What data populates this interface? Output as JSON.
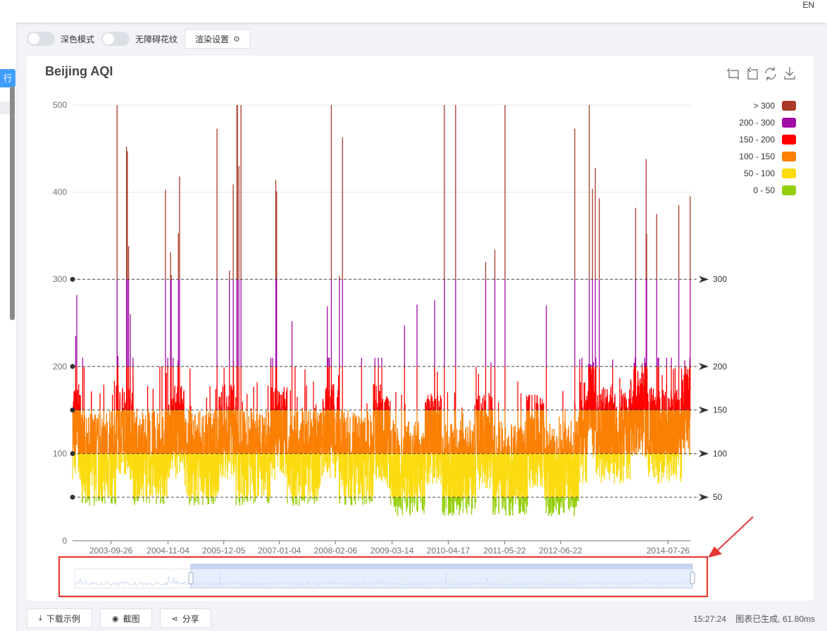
{
  "lang": "EN",
  "sidebar": {
    "run_label": "行"
  },
  "options": {
    "dark_mode": "深色模式",
    "a11y_pattern": "无障碍花纹",
    "render_settings": "渲染设置"
  },
  "bottom": {
    "download": "下载示例",
    "screenshot": "截图",
    "share": "分享"
  },
  "status": {
    "time": "15:27:24",
    "message": "图表已生成, 61.80ms"
  },
  "colors": {
    "gt300": "#aa3a28",
    "200-300": "#a10ba6",
    "150-200": "#ff0000",
    "100-150": "#fb7f03",
    "50-100": "#fbdb0f",
    "0-50": "#93ce07",
    "accent": "#409eff",
    "dataZoom": "#d6e2f8"
  },
  "chart_data": {
    "type": "line",
    "title": "Beijing AQI",
    "ylim": [
      0,
      500
    ],
    "yticks": [
      0,
      100,
      200,
      300,
      400,
      500
    ],
    "xticks": [
      "2003-09-26",
      "2004-11-04",
      "2005-12-05",
      "2007-01-04",
      "2008-02-06",
      "2009-03-14",
      "2010-04-17",
      "2011-05-22",
      "2012-06-22",
      "2014-07-26"
    ],
    "x_range": [
      "2002-12-27",
      "2014-12-31"
    ],
    "mark_lines": [
      50,
      100,
      150,
      200,
      300
    ],
    "mark_line_labels": [
      "50",
      "100",
      "150",
      "200",
      "300"
    ],
    "legend": [
      {
        "label": "> 300",
        "color_key": "gt300"
      },
      {
        "label": "200 - 300",
        "color_key": "200-300"
      },
      {
        "label": "150 - 200",
        "color_key": "150-200"
      },
      {
        "label": "100 - 150",
        "color_key": "100-150"
      },
      {
        "label": "50 - 100",
        "color_key": "50-100"
      },
      {
        "label": "0 - 50",
        "color_key": "0-50"
      }
    ],
    "peaks": [
      [
        "2003-01-18",
        235
      ],
      [
        "2003-01-26",
        282
      ],
      [
        "2003-11-08",
        500
      ],
      [
        "2003-11-14",
        212
      ],
      [
        "2004-01-14",
        452
      ],
      [
        "2004-01-20",
        447
      ],
      [
        "2004-01-29",
        338
      ],
      [
        "2004-02-10",
        260
      ],
      [
        "2004-10-17",
        403
      ],
      [
        "2004-11-22",
        331
      ],
      [
        "2004-11-27",
        305
      ],
      [
        "2005-01-17",
        353
      ],
      [
        "2005-01-25",
        418
      ],
      [
        "2005-10-18",
        473
      ],
      [
        "2006-01-14",
        310
      ],
      [
        "2006-02-10",
        409
      ],
      [
        "2006-03-08",
        500
      ],
      [
        "2006-03-12",
        500
      ],
      [
        "2006-03-22",
        430
      ],
      [
        "2006-04-06",
        500
      ],
      [
        "2006-12-09",
        414
      ],
      [
        "2006-12-15",
        401
      ],
      [
        "2007-04-03",
        252
      ],
      [
        "2007-12-10",
        269
      ],
      [
        "2008-01-08",
        500
      ],
      [
        "2008-03-05",
        304
      ],
      [
        "2008-03-27",
        463
      ],
      [
        "2009-06-10",
        247
      ],
      [
        "2009-09-07",
        271
      ],
      [
        "2010-01-10",
        276
      ],
      [
        "2010-03-20",
        500
      ],
      [
        "2010-06-08",
        500
      ],
      [
        "2011-01-08",
        320
      ],
      [
        "2011-03-14",
        334
      ],
      [
        "2011-05-25",
        500
      ],
      [
        "2012-03-13",
        270
      ],
      [
        "2012-10-01",
        473
      ],
      [
        "2013-01-12",
        500
      ],
      [
        "2013-02-04",
        404
      ],
      [
        "2013-02-24",
        428
      ],
      [
        "2013-03-24",
        393
      ],
      [
        "2013-12-08",
        382
      ],
      [
        "2014-02-20",
        438
      ],
      [
        "2014-02-24",
        352
      ],
      [
        "2014-05-06",
        375
      ],
      [
        "2014-10-10",
        385
      ],
      [
        "2014-12-30",
        395
      ]
    ]
  }
}
